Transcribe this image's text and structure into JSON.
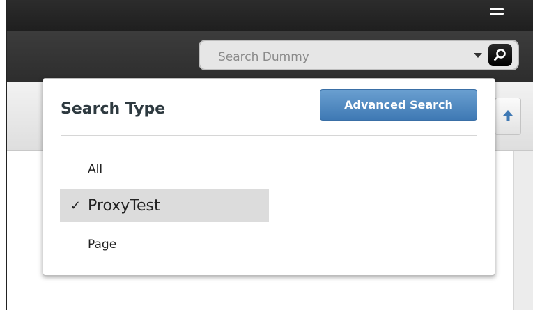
{
  "search": {
    "placeholder": "Search Dummy",
    "value": ""
  },
  "popover": {
    "title": "Search Type",
    "advanced_label": "Advanced Search",
    "options": [
      {
        "label": "All",
        "selected": false
      },
      {
        "label": "ProxyTest",
        "selected": true
      },
      {
        "label": "Page",
        "selected": false
      }
    ],
    "check_mark": "✓"
  },
  "icons": {
    "menu": "menu-icon",
    "search": "search-icon",
    "dropdown": "chevron-down-icon",
    "toolbar": "arrow-up-icon"
  },
  "colors": {
    "accent": "#4a86c0",
    "selected_row": "#dcdcdc",
    "topbar": "#262626"
  }
}
